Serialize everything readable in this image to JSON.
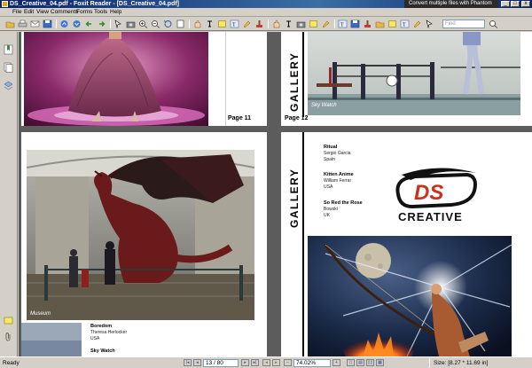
{
  "window": {
    "title": "DS_Creative_04.pdf - Foxit Reader - [DS_Creative_04.pdf]",
    "promo_text": "Convert multiple files with Phantom",
    "controls": {
      "minimize": "_",
      "restore": "□",
      "close": "x"
    }
  },
  "menubar": {
    "items": [
      "File",
      "Edit",
      "View",
      "Comments",
      "Forms",
      "Tools",
      "Help"
    ]
  },
  "toolbar": {
    "icons": [
      "open-icon",
      "print-icon",
      "email-icon",
      "save-icon",
      "prev-icon",
      "next-icon",
      "back-icon",
      "forward-icon",
      "select-icon",
      "snapshot-icon",
      "zoom-in-icon",
      "zoom-out-icon",
      "rotate-icon",
      "fit-page-icon",
      "hand-icon",
      "text-select-icon",
      "note-icon",
      "typewriter-icon",
      "highlight-icon",
      "stamp-icon",
      "find-icon"
    ],
    "find_placeholder": "Find"
  },
  "pages": {
    "page11": {
      "label": "Page 11"
    },
    "page12": {
      "label": "Page 12",
      "gallery": "GALLERY",
      "caption": "Sky Watch"
    },
    "page13": {
      "caption": "Museum",
      "entries": [
        {
          "title": "Boredom",
          "lines": [
            "Theresa Herlocker",
            "USA"
          ]
        },
        {
          "title": "Sky Watch",
          "lines": []
        }
      ]
    },
    "page14": {
      "gallery": "GALLERY",
      "entries": [
        {
          "title": "Ritual",
          "lines": [
            "Sergio Garcia",
            "Spain"
          ]
        },
        {
          "title": "Kitten Anime",
          "lines": [
            "William Ferrar",
            "USA"
          ]
        },
        {
          "title": "So Red the Rose",
          "lines": [
            "Bowski",
            "UK"
          ]
        }
      ],
      "logo_mark": "DS",
      "logo_text": "CREATIVE"
    }
  },
  "statusbar": {
    "ready": "Ready",
    "page_indicator": "13 / 80",
    "zoom": "74.02%",
    "size": "Size: [8.27 * 11.69 in]"
  },
  "colors": {
    "titlebar": "#0a246a",
    "chrome": "#d4d0c8",
    "doc_bg": "#5c5c5c",
    "logo_red": "#c8321e"
  }
}
